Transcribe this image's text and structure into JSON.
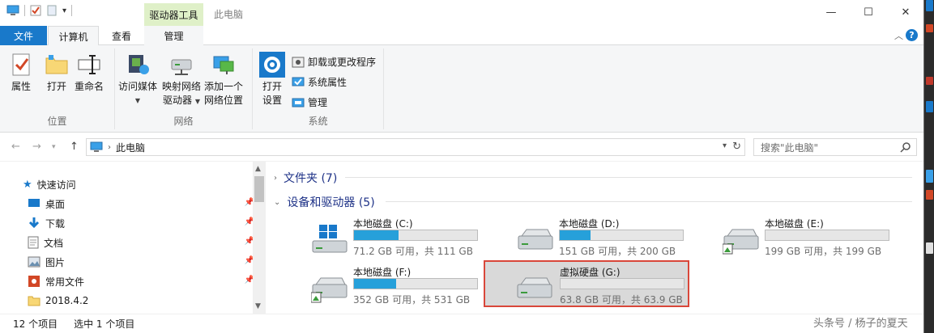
{
  "window": {
    "contextual_tab": "驱动器工具",
    "title": "此电脑",
    "buttons": {
      "minimize": "—",
      "maximize": "☐",
      "close": "✕"
    }
  },
  "tabs": {
    "file": "文件",
    "computer": "计算机",
    "view": "查看",
    "manage": "管理"
  },
  "ribbon": {
    "location": {
      "label": "位置",
      "properties": "属性",
      "open": "打开",
      "rename": "重命名"
    },
    "network": {
      "label": "网络",
      "access_media": "访问媒体",
      "map_drive_line1": "映射网络",
      "map_drive_line2": "驱动器",
      "add_location_line1": "添加一个",
      "add_location_line2": "网络位置"
    },
    "system": {
      "label": "系统",
      "open_settings_line1": "打开",
      "open_settings_line2": "设置",
      "uninstall": "卸载或更改程序",
      "system_properties": "系统属性",
      "manage": "管理"
    }
  },
  "address": {
    "crumb": "此电脑"
  },
  "search": {
    "placeholder": "搜索\"此电脑\""
  },
  "navpane": {
    "quick_access": "快速访问",
    "items": [
      {
        "label": "桌面",
        "pinned": true
      },
      {
        "label": "下载",
        "pinned": true
      },
      {
        "label": "文档",
        "pinned": true
      },
      {
        "label": "图片",
        "pinned": true
      },
      {
        "label": "常用文件",
        "pinned": true
      },
      {
        "label": "2018.4.2",
        "pinned": false
      }
    ]
  },
  "content": {
    "folders_header": "文件夹 (7)",
    "devices_header": "设备和驱动器 (5)",
    "drives": [
      {
        "name": "本地磁盘 (C:)",
        "info": "71.2 GB 可用，共 111 GB",
        "used_fraction": 0.36
      },
      {
        "name": "本地磁盘 (D:)",
        "info": "151 GB 可用，共 200 GB",
        "used_fraction": 0.25
      },
      {
        "name": "本地磁盘 (E:)",
        "info": "199 GB 可用，共 199 GB",
        "used_fraction": 0.0
      },
      {
        "name": "本地磁盘 (F:)",
        "info": "352 GB 可用，共 531 GB",
        "used_fraction": 0.34
      },
      {
        "name": "虚拟硬盘 (G:)",
        "info": "63.8 GB 可用，共 63.9 GB",
        "used_fraction": 0.0
      }
    ]
  },
  "status": {
    "count": "12 个项目",
    "selected": "选中 1 个项目"
  },
  "watermark": "头条号 / 杨子的夏天",
  "colors": {
    "accent": "#1979ca",
    "drive_bar": "#26a0da",
    "contextual": "#dff0c8",
    "selection_border": "#d9473a"
  }
}
